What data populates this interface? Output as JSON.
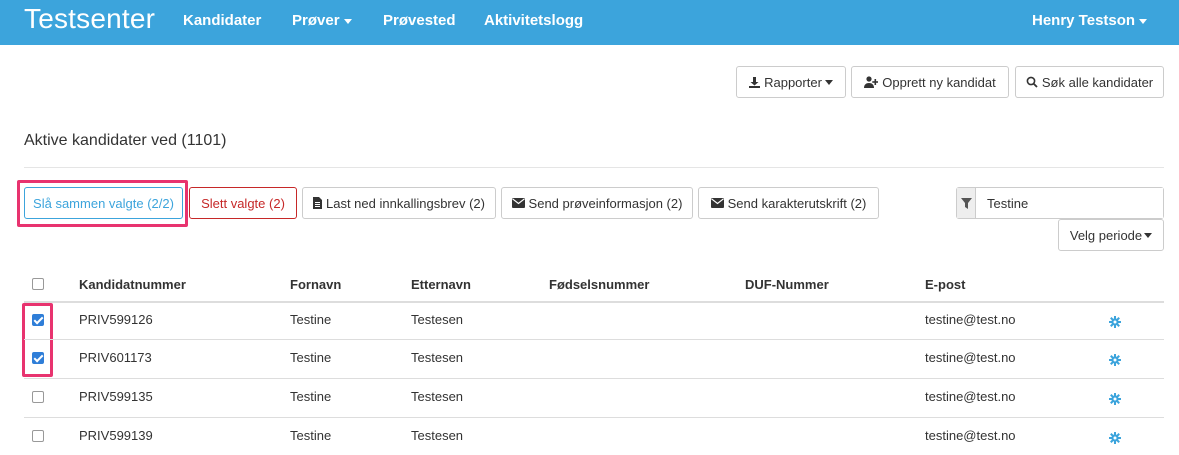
{
  "navbar": {
    "brand": "Testsenter",
    "items": [
      {
        "label": "Kandidater"
      },
      {
        "label": "Prøver"
      },
      {
        "label": "Prøvested"
      },
      {
        "label": "Aktivitetslogg"
      }
    ],
    "user": "Henry Testson"
  },
  "toolbar": {
    "reports_label": "Rapporter",
    "new_candidate_label": "Opprett ny kandidat",
    "search_all_label": "Søk alle kandidater"
  },
  "section": {
    "title": "Aktive kandidater ved (1101)"
  },
  "actions": {
    "merge_label": "Slå sammen valgte (2/2)",
    "delete_label": "Slett valgte (2)",
    "download_label": "Last ned innkallingsbrev (2)",
    "send_info_label": "Send prøveinformasjon (2)",
    "send_grades_label": "Send karakterutskrift (2)"
  },
  "filter": {
    "value": "Testine",
    "period_label": "Velg periode"
  },
  "table": {
    "headers": [
      "Kandidatnummer",
      "Fornavn",
      "Etternavn",
      "Fødselsnummer",
      "DUF-Nummer",
      "E-post"
    ],
    "rows": [
      {
        "checked": true,
        "number": "PRIV599126",
        "first": "Testine",
        "last": "Testesen",
        "email": "testine@test.no"
      },
      {
        "checked": true,
        "number": "PRIV601173",
        "first": "Testine",
        "last": "Testesen",
        "email": "testine@test.no"
      },
      {
        "checked": false,
        "number": "PRIV599135",
        "first": "Testine",
        "last": "Testesen",
        "email": "testine@test.no"
      },
      {
        "checked": false,
        "number": "PRIV599139",
        "first": "Testine",
        "last": "Testesen",
        "email": "testine@test.no"
      }
    ]
  },
  "colors": {
    "navbar": "#3ca4dc",
    "highlight": "#e8336f",
    "checkbox": "#2f7ed8",
    "gear": "#3ca4dc"
  }
}
